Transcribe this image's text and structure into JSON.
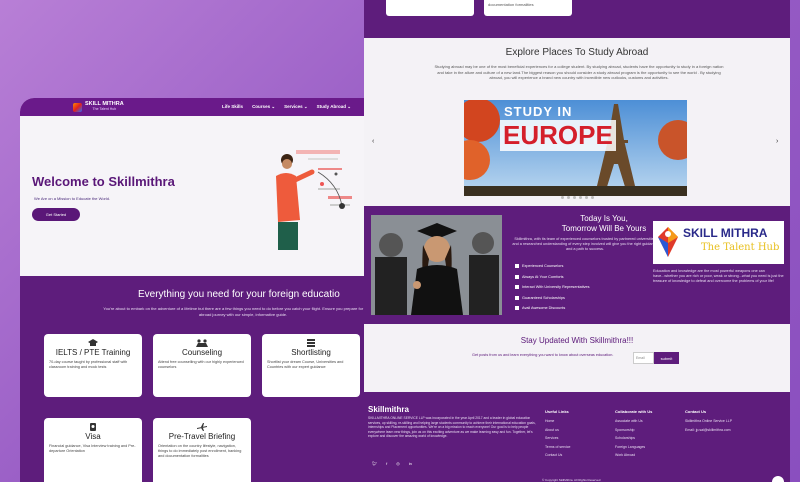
{
  "left": {
    "nav": {
      "brand": "SKILL MITHRA",
      "brand_sub": "The Talent Hub",
      "menu": [
        "Life Skills",
        "Courses ⌄",
        "Services ⌄",
        "Study Abroad ⌄"
      ]
    },
    "hero": {
      "title": "Welcome to Skillmithra",
      "subtitle": "We Are on a Mission to Educate the World.",
      "button": "Get Started"
    },
    "section": {
      "title": "Everything you need for your foreign educatio",
      "description": "You're about to embark on the adventure of a lifetime but there are a few things you need to do before you catch your flight. Ensure you prepare for your study abroad journey with our simple, informative guide."
    },
    "cards": [
      {
        "icon": "graduation-cap-icon",
        "title": "IELTS / PTE Training",
        "desc": "70-day course taught by professional staff with classroom training and mock tests"
      },
      {
        "icon": "handshake-icon",
        "title": "Counseling",
        "desc": "Attend free counselling with our highly experienced counselors"
      },
      {
        "icon": "list-icon",
        "title": "Shortlisting",
        "desc": "Shortlist your dream Course, Universities and Countries with our expert guidance"
      },
      {
        "icon": "passport-icon",
        "title": "Visa",
        "desc": "Financial guidance, Visa Interview training and Pre-departure Orientation"
      },
      {
        "icon": "plane-icon",
        "title": "Pre-Travel Briefing",
        "desc": "Orientation on the country lifestyle, navigation, things to do immediately post enrollment, banking and documentation formalities"
      }
    ]
  },
  "right": {
    "top_boxes": [
      "documentation formalities"
    ],
    "explore": {
      "title": "Explore Places To Study Abroad",
      "description": "Studying abroad may be one of the most beneficial experiences for a college student. By studying abroad, students have the opportunity to study in a foreign nation and take in the allure and culture of a new land.The biggest reason you should consider a study abroad program is the opportunity to see the world . By studying abroad, you will experience a brand new country with incredible new outlooks, customs and activities.",
      "slide_line1": "STUDY IN",
      "slide_line2": "EUROPE",
      "prev": "‹",
      "next": "›"
    },
    "today": {
      "title_line1": "Today Is You,",
      "title_line2": "Tomorrow Will Be Yours",
      "description": "Skillmithra, with its team of experienced counselors trusted by partnered universities and a researched understanding of every step involved will give you the right guidance and a path to success.",
      "list": [
        "Experienced Counselors",
        "Always At Your Comforts",
        "Interact With University Representatives",
        "Guaranteed Scholarships",
        "Avail Awesome Discounts"
      ],
      "logo_line1": "SKILL MITHRA",
      "logo_line2": "The Talent Hub",
      "logo_desc": "Education and knowledge are the most powerful weapons one can have...whether you are rich or poor, weak or strong...what you need is just the treasure of knowledge to defeat and overcome the problems of your life!"
    },
    "stay": {
      "title": "Stay Updated With Skillmithra!!!",
      "description": "Get posts from us and learn everything you want to know about overseas education.",
      "email_placeholder": "Email",
      "submit": "submit"
    },
    "footer": {
      "brand": "Skillmithra",
      "about": "SKILLMITHRA ONLINE SERVICE LLP was incorporated in the year April 2017 and a leader in global education services, up skilling, re-skilling and helping large students community to achieve their international education goals, internships and Placement opportunities. We're on a big mission to reach everyone! Our goal is to help people everywhere learn new things, join us on this exciting adventure as we make learning easy and fun. Together, let's explore and discover the amazing world of knowledge.",
      "col1_title": "Useful Links",
      "col1": [
        "Home",
        "About us",
        "Services",
        "Terms of service",
        "Contact Us"
      ],
      "col2_title": "Collaborate with Us",
      "col2": [
        "Associate with Us",
        "Sponsorship",
        "Scholarships",
        "Foreign Languages",
        "Work Abroad"
      ],
      "col3_title": "Contact Us",
      "col3": [
        "Skillmithra Online Service LLP",
        "Email: jp.sai@skillmithra.com"
      ],
      "social": [
        "twitter-icon",
        "facebook-icon",
        "instagram-icon",
        "linkedin-icon"
      ],
      "copyright": "© Copyright SkillMithra. All Rights Reserved"
    }
  },
  "colors": {
    "primary": "#5e1d7c",
    "hero_title": "#5a1778",
    "europe_red": "#d41f2b"
  }
}
